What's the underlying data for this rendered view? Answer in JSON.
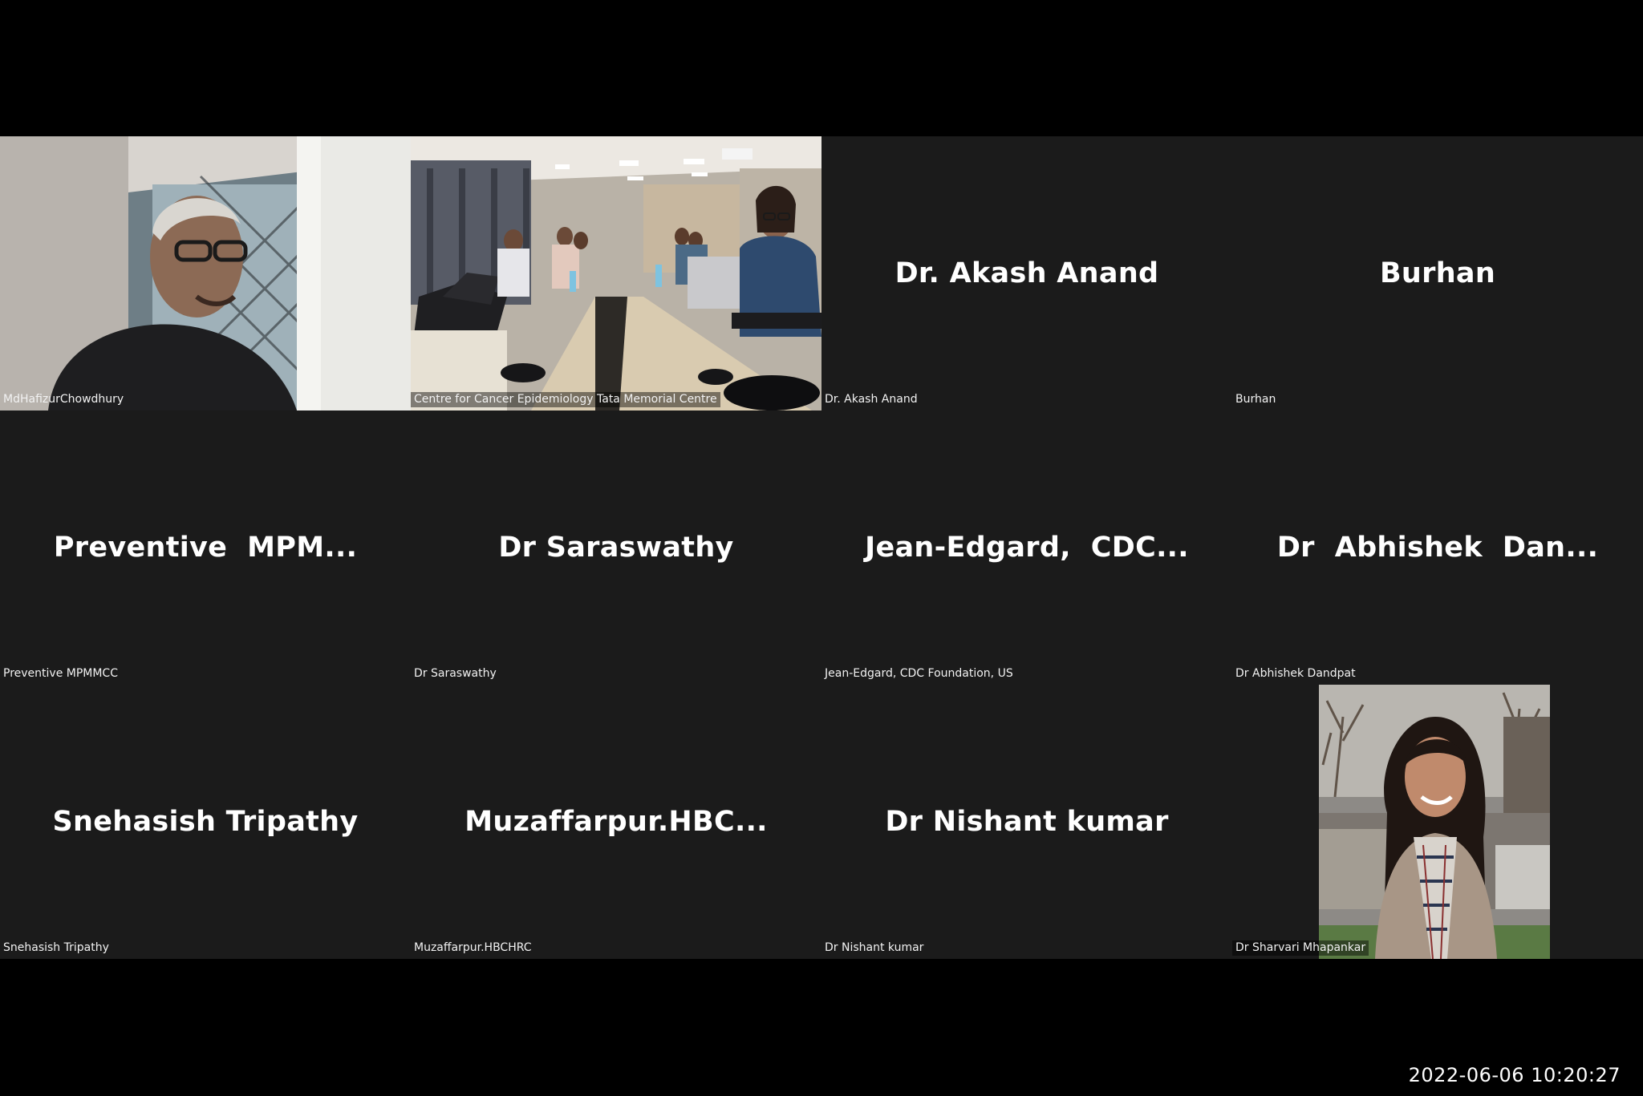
{
  "meeting": {
    "timestamp": "2022-06-06 10:20:27",
    "background_color": "#000000",
    "tile_color": "#1b1b1b"
  },
  "tiles": [
    {
      "display_name": "",
      "label": "MdHafizurChowdhury",
      "video": "man-speaking-video"
    },
    {
      "display_name": "",
      "label": "Centre for Cancer Epidemiology Tata Memorial Centre",
      "video": "conference-room-video"
    },
    {
      "display_name": "Dr. Akash Anand",
      "label": "Dr. Akash Anand"
    },
    {
      "display_name": "Burhan",
      "label": "Burhan"
    },
    {
      "display_name": "Preventive  MPM...",
      "label": "Preventive MPMMCC"
    },
    {
      "display_name": "Dr Saraswathy",
      "label": "Dr Saraswathy"
    },
    {
      "display_name": "Jean-Edgard,  CDC...",
      "label": "Jean-Edgard, CDC Foundation, US"
    },
    {
      "display_name": "Dr  Abhishek  Dan...",
      "label": "Dr Abhishek Dandpat"
    },
    {
      "display_name": "Snehasish Tripathy",
      "label": "Snehasish Tripathy"
    },
    {
      "display_name": "Muzaffarpur.HBC...",
      "label": "Muzaffarpur.HBCHRC"
    },
    {
      "display_name": "Dr Nishant kumar",
      "label": "Dr Nishant kumar"
    },
    {
      "display_name": "",
      "label": "Dr Sharvari Mhapankar",
      "video": "woman-portrait-photo"
    }
  ]
}
